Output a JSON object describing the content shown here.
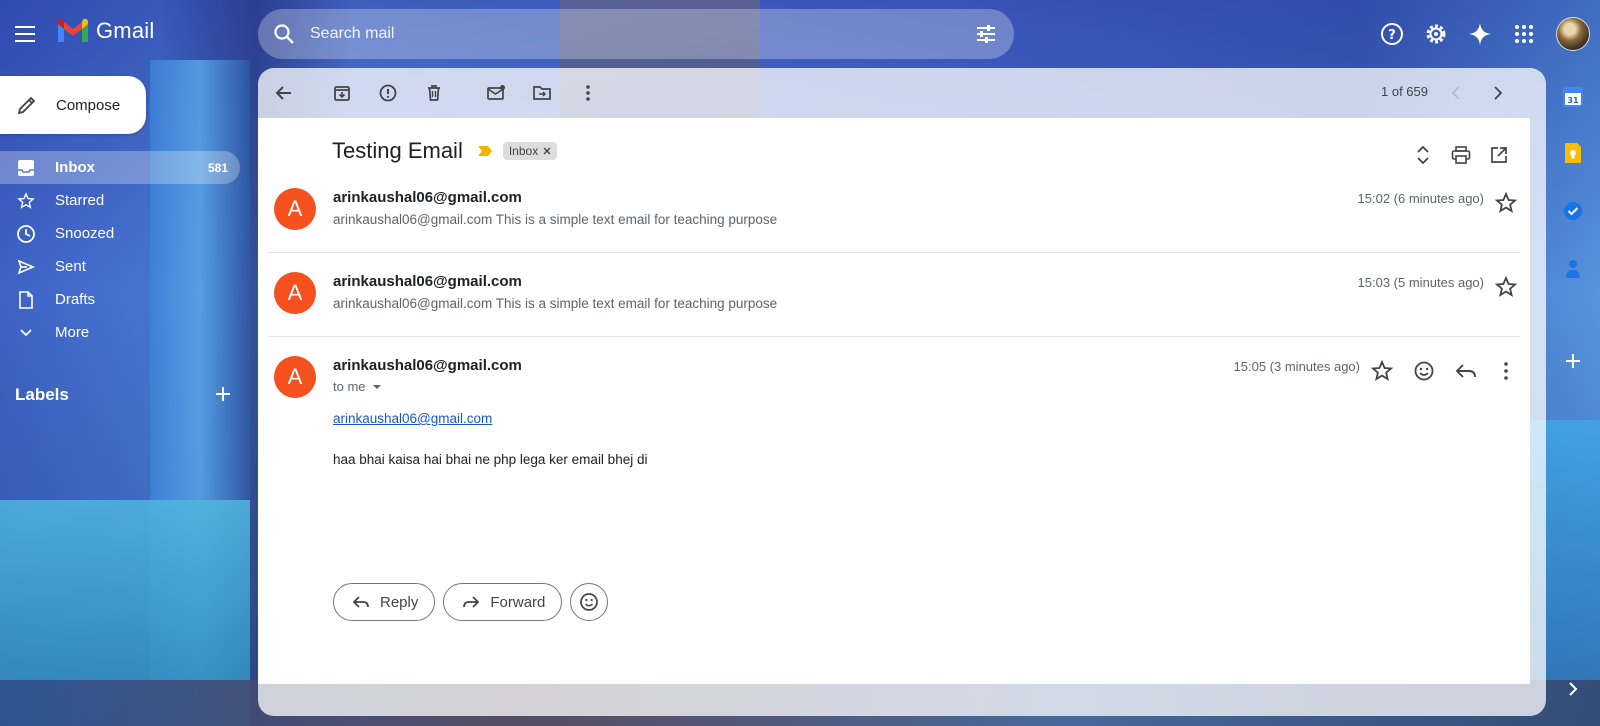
{
  "app": {
    "logo_text": "Gmail"
  },
  "search": {
    "placeholder": "Search mail"
  },
  "compose": {
    "label": "Compose"
  },
  "nav": {
    "items": [
      {
        "label": "Inbox",
        "count": "581",
        "icon": "inbox-icon"
      },
      {
        "label": "Starred",
        "icon": "star-icon"
      },
      {
        "label": "Snoozed",
        "icon": "clock-icon"
      },
      {
        "label": "Sent",
        "icon": "send-icon"
      },
      {
        "label": "Drafts",
        "icon": "draft-icon"
      },
      {
        "label": "More",
        "icon": "chevron-down-icon"
      }
    ],
    "labels_title": "Labels"
  },
  "toolbar": {
    "pager": "1 of 659"
  },
  "thread": {
    "subject": "Testing Email",
    "chip": "Inbox",
    "messages": [
      {
        "avatar": "A",
        "from": "arinkaushal06@gmail.com",
        "snippet": "arinkaushal06@gmail.com This is a simple text email for teaching purpose",
        "time": "15:02 (6 minutes ago)"
      },
      {
        "avatar": "A",
        "from": "arinkaushal06@gmail.com",
        "snippet": "arinkaushal06@gmail.com This is a simple text email for teaching purpose",
        "time": "15:03 (5 minutes ago)"
      },
      {
        "avatar": "A",
        "from": "arinkaushal06@gmail.com",
        "to": "to me",
        "time": "15:05 (3 minutes ago)",
        "link": "arinkaushal06@gmail.com",
        "body": "haa bhai kaisa hai bhai ne php lega ker email bhej di"
      }
    ],
    "reply_label": "Reply",
    "forward_label": "Forward"
  },
  "colors": {
    "avatar": "#f4511e",
    "accent": "#1a73e8"
  },
  "side_panel": {
    "calendar_day": "31"
  }
}
